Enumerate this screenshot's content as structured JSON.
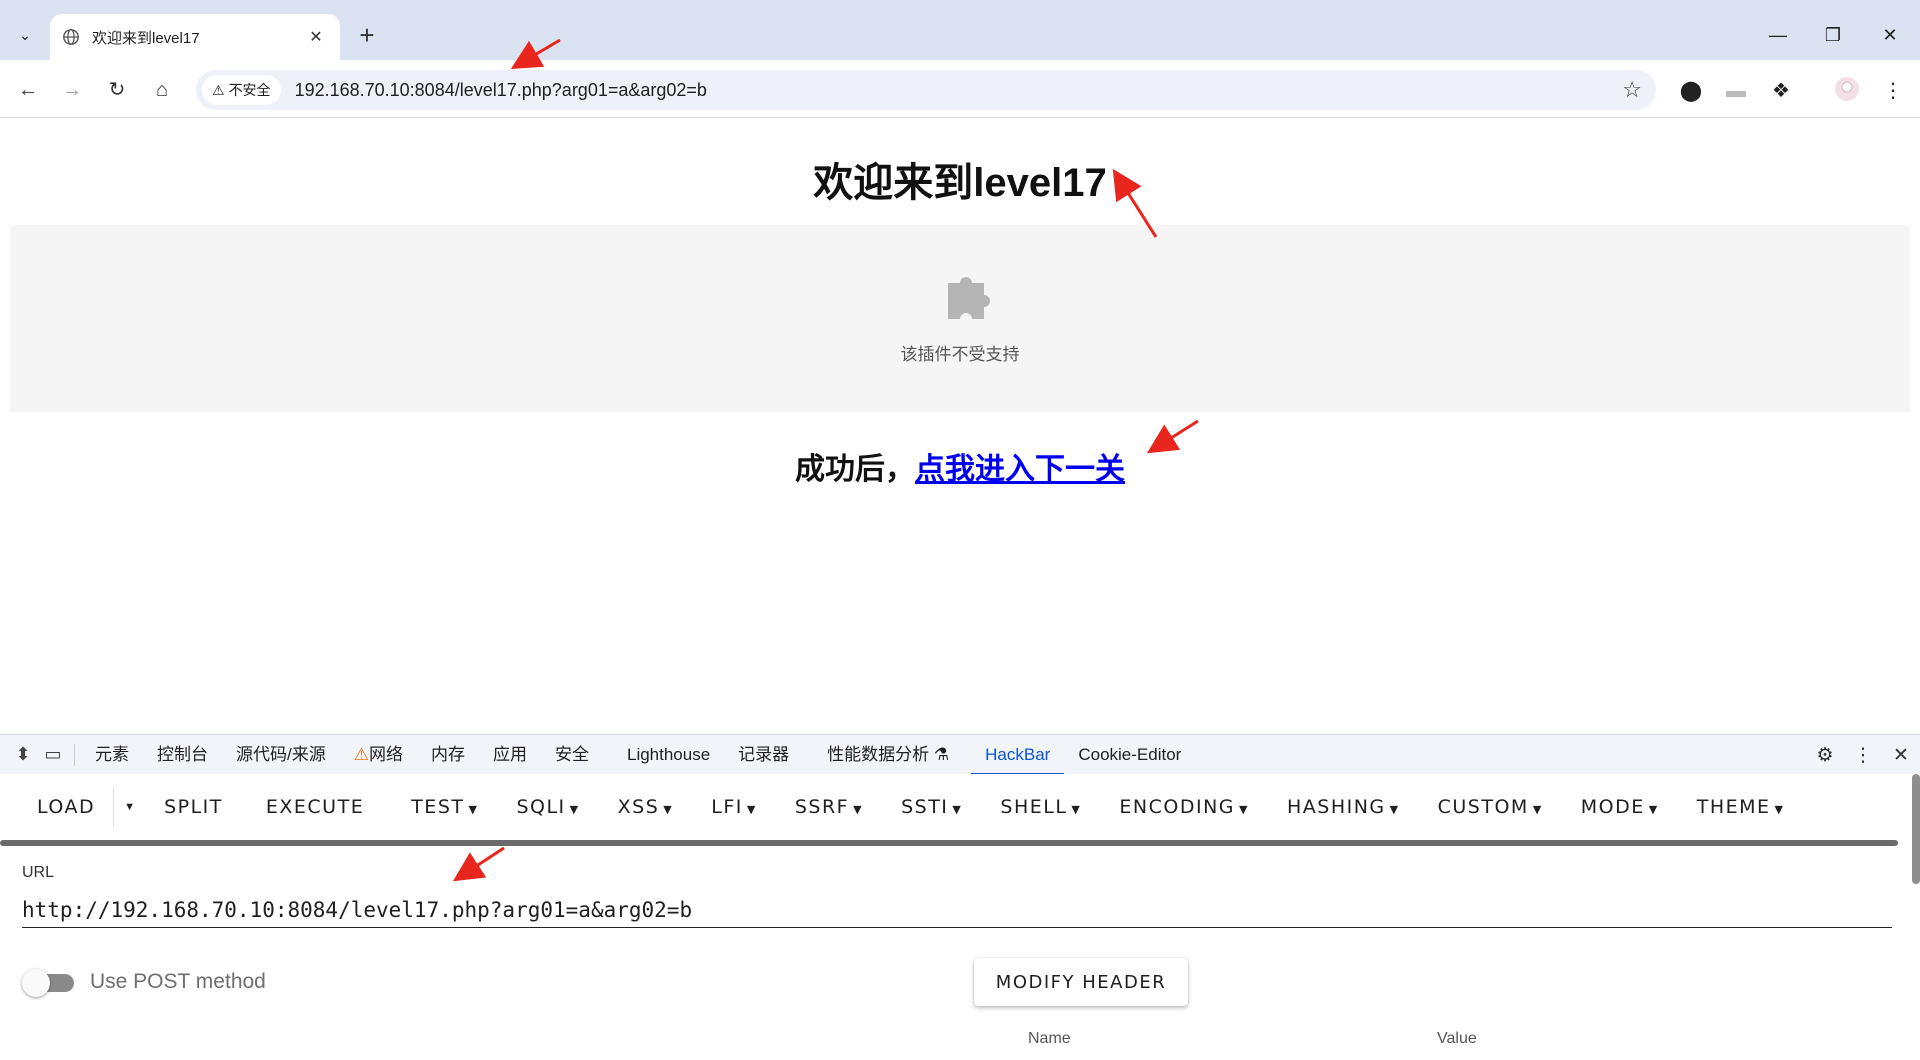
{
  "browser": {
    "tab_title": "欢迎来到level17",
    "new_tab": "+",
    "tab_close": "✕",
    "security_label": "不安全",
    "url": "192.168.70.10:8084/level17.php?arg01=a&arg02=b"
  },
  "page": {
    "heading": "欢迎来到level17",
    "plugin_unsupported": "该插件不受支持",
    "next_prefix": "成功后，",
    "next_link": "点我进入下一关"
  },
  "devtools": {
    "tabs": [
      "元素",
      "控制台",
      "源代码/来源",
      "网络",
      "内存",
      "应用",
      "安全",
      "Lighthouse",
      "记录器",
      "性能数据分析",
      "HackBar",
      "Cookie-Editor"
    ],
    "active_tab": "HackBar"
  },
  "hackbar": {
    "menu": {
      "load": "LOAD",
      "split": "SPLIT",
      "execute": "EXECUTE",
      "test": "TEST",
      "sqli": "SQLI",
      "xss": "XSS",
      "lfi": "LFI",
      "ssrf": "SSRF",
      "ssti": "SSTI",
      "shell": "SHELL",
      "encoding": "ENCODING",
      "hashing": "HASHING",
      "custom": "CUSTOM",
      "mode": "MODE",
      "theme": "THEME"
    },
    "url_label": "URL",
    "url_value": "http://192.168.70.10:8084/level17.php?arg01=a&arg02=b",
    "post_label": "Use POST method",
    "post_enabled": false,
    "modify_header": "MODIFY HEADER",
    "header_col_name": "Name",
    "header_col_value": "Value"
  },
  "colors": {
    "link": "#0000ee",
    "active_tab": "#0b57d0",
    "annotation_arrow": "#e8261d"
  }
}
